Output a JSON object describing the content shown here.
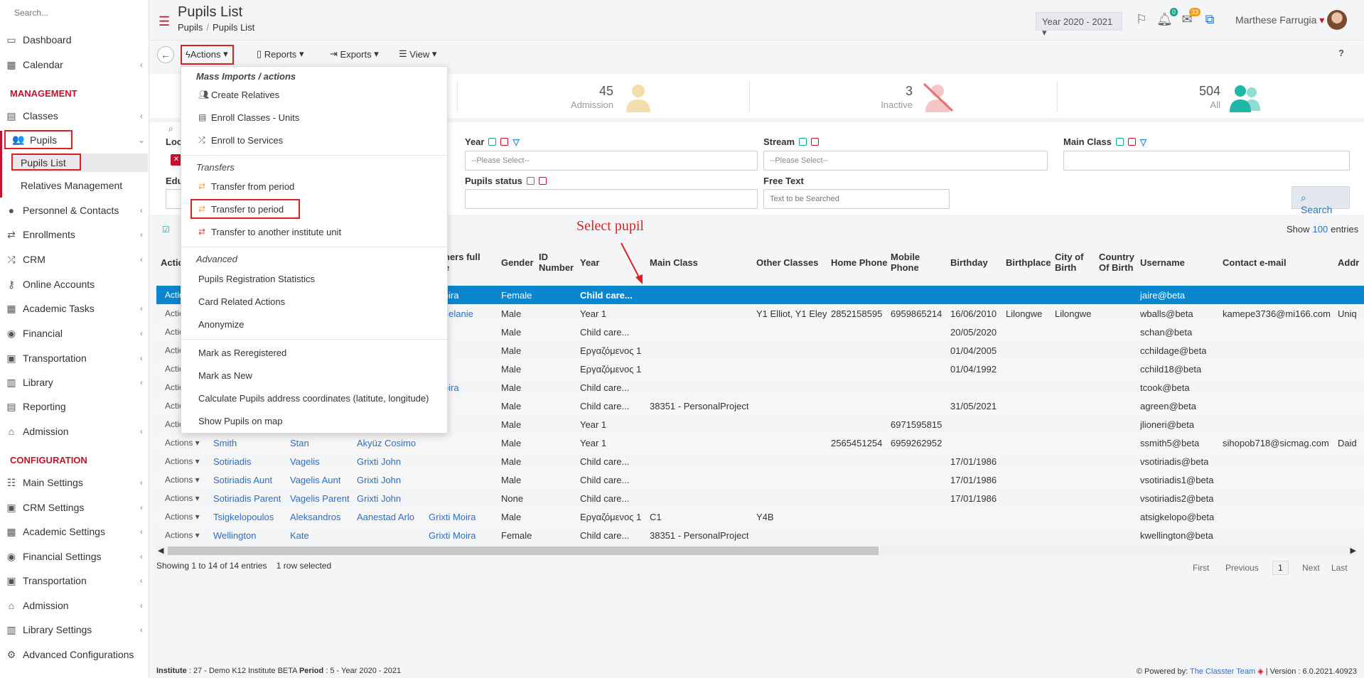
{
  "sidebar": {
    "search_placeholder": "Search...",
    "items": [
      {
        "label": "Dashboard",
        "icon": "monitor-icon"
      },
      {
        "label": "Calendar",
        "icon": "calendar-icon"
      },
      {
        "label": "Classes",
        "icon": "classes-icon"
      },
      {
        "label": "Pupils",
        "icon": "users-icon"
      },
      {
        "label": "Personnel & Contacts",
        "icon": "person-icon"
      },
      {
        "label": "Enrollments",
        "icon": "arrows-icon"
      },
      {
        "label": "CRM",
        "icon": "crm-icon"
      },
      {
        "label": "Online Accounts",
        "icon": "key-icon"
      },
      {
        "label": "Academic Tasks",
        "icon": "grid-icon"
      },
      {
        "label": "Financial",
        "icon": "coins-icon"
      },
      {
        "label": "Transportation",
        "icon": "bus-icon"
      },
      {
        "label": "Library",
        "icon": "books-icon"
      },
      {
        "label": "Reporting",
        "icon": "report-icon"
      },
      {
        "label": "Admission",
        "icon": "bank-icon"
      }
    ],
    "sections": {
      "management": "MANAGEMENT",
      "configuration": "CONFIGURATION"
    },
    "sub_items": [
      "Pupils List",
      "Relatives Management"
    ],
    "config_items": [
      "Main Settings",
      "CRM Settings",
      "Academic Settings",
      "Financial Settings",
      "Transportation",
      "Admission",
      "Library Settings",
      "Advanced Configurations"
    ]
  },
  "header": {
    "title": "Pupils List",
    "breadcrumb": [
      "Pupils",
      "Pupils List"
    ],
    "year": "Year 2020 - 2021",
    "notif_count": "0",
    "mail_count": "33",
    "user": "Marthese Farrugia"
  },
  "toolbar": {
    "actions": "Actions",
    "reports": "Reports",
    "exports": "Exports",
    "view": "View",
    "help": "?"
  },
  "stats": [
    {
      "num": "45",
      "label": "Admission"
    },
    {
      "num": "3",
      "label": "Inactive"
    },
    {
      "num": "504",
      "label": "All"
    }
  ],
  "filters": {
    "loc": "Loc",
    "edu": "Edu",
    "year": "Year",
    "stream": "Stream",
    "main_class": "Main Class",
    "pupils_status": "Pupils status",
    "free_text": "Free Text",
    "please_select": "--Please Select--",
    "free_text_placeholder": "Text to be Searched",
    "search": "Search",
    "show": "Show",
    "show_value": "100",
    "entries": "entries"
  },
  "annotation": "Select pupil",
  "menu": {
    "h1": "Mass Imports / actions",
    "create_relatives": "Create Relatives",
    "enroll_classes": "Enroll Classes - Units",
    "enroll_services": "Enroll to Services",
    "h2": "Transfers",
    "transfer_from": "Transfer from period",
    "transfer_to": "Transfer to period",
    "transfer_unit": "Transfer to another institute unit",
    "h3": "Advanced",
    "reg_stats": "Pupils Registration Statistics",
    "card_actions": "Card Related Actions",
    "anonymize": "Anonymize",
    "reregistered": "Mark as Reregistered",
    "mark_new": "Mark as New",
    "calc_coords": "Calculate Pupils address coordinates (latitute, longitude)",
    "show_map": "Show Pupils on map"
  },
  "table": {
    "headers": {
      "actions": "Actio",
      "others_a": "hers full",
      "others_b": "e",
      "gender": "Gender",
      "id_a": "ID",
      "id_b": "Number",
      "year": "Year",
      "main_class": "Main Class",
      "other_classes": "Other Classes",
      "home_phone": "Home Phone",
      "mobile_a": "Mobile",
      "mobile_b": "Phone",
      "birthday": "Birthday",
      "birthplace": "Birthplace",
      "city_a": "City of",
      "city_b": "Birth",
      "country_a": "Country",
      "country_b": "Of Birth",
      "username": "Username",
      "email": "Contact e-mail",
      "addr": "Addr"
    },
    "rows": [
      {
        "act": "Actio",
        "surname": "",
        "name": "",
        "father": "",
        "other": "ti Moira",
        "gender": "Female",
        "year": "Child care...",
        "main": "",
        "otherc": "",
        "home": "",
        "mobile": "",
        "bday": "",
        "bplace": "",
        "city": "",
        "user": "jaire@beta",
        "email": "",
        "addr": ""
      },
      {
        "act": "Actio",
        "surname": "",
        "name": "",
        "father": "",
        "other": "es Melanie",
        "gender": "Male",
        "year": "Year 1",
        "main": "",
        "otherc": "Y1 Elliot, Y1 Eley",
        "home": "2852158595",
        "mobile": "6959865214",
        "bday": "16/06/2010",
        "bplace": "Lilongwe",
        "city": "Lilongwe",
        "user": "wballs@beta",
        "email": "kamepe3736@mi166.com",
        "addr": "Uniq"
      },
      {
        "act": "Actio",
        "surname": "",
        "name": "",
        "father": "",
        "other": "",
        "gender": "Male",
        "year": "Child care...",
        "main": "",
        "otherc": "",
        "home": "",
        "mobile": "",
        "bday": "20/05/2020",
        "bplace": "",
        "city": "",
        "user": "schan@beta",
        "email": "",
        "addr": ""
      },
      {
        "act": "Actio",
        "surname": "",
        "name": "",
        "father": "",
        "other": "",
        "gender": "Male",
        "year": "Εργαζόμενος 1",
        "main": "",
        "otherc": "",
        "home": "",
        "mobile": "",
        "bday": "01/04/2005",
        "bplace": "",
        "city": "",
        "user": "cchildage@beta",
        "email": "",
        "addr": ""
      },
      {
        "act": "Actio",
        "surname": "",
        "name": "",
        "father": "",
        "other": "",
        "gender": "Male",
        "year": "Εργαζόμενος 1",
        "main": "",
        "otherc": "",
        "home": "",
        "mobile": "",
        "bday": "01/04/1992",
        "bplace": "",
        "city": "",
        "user": "cchild18@beta",
        "email": "",
        "addr": ""
      },
      {
        "act": "Actio",
        "surname": "",
        "name": "",
        "father": "",
        "other": "ti Moira",
        "gender": "Male",
        "year": "Child care...",
        "main": "",
        "otherc": "",
        "home": "",
        "mobile": "",
        "bday": "",
        "bplace": "",
        "city": "",
        "user": "tcook@beta",
        "email": "",
        "addr": ""
      },
      {
        "act": "Actio",
        "surname": "",
        "name": "",
        "father": "",
        "other": "",
        "gender": "Male",
        "year": "Child care...",
        "main": "38351 - PersonalProject",
        "otherc": "",
        "home": "",
        "mobile": "",
        "bday": "31/05/2021",
        "bplace": "",
        "city": "",
        "user": "agreen@beta",
        "email": "",
        "addr": ""
      },
      {
        "act": "Actio",
        "surname": "",
        "name": "",
        "father": "",
        "other": "",
        "gender": "Male",
        "year": "Year 1",
        "main": "",
        "otherc": "",
        "home": "",
        "mobile": "6971595815",
        "bday": "",
        "bplace": "",
        "city": "",
        "user": "jlioneri@beta",
        "email": "",
        "addr": ""
      },
      {
        "act": "Actions",
        "surname": "Smith",
        "name": "Stan",
        "father": "Akyüz Cosimo",
        "other": "",
        "gender": "Male",
        "year": "Year 1",
        "main": "",
        "otherc": "",
        "home": "2565451254",
        "mobile": "6959262952",
        "bday": "",
        "bplace": "",
        "city": "",
        "user": "ssmith5@beta",
        "email": "sihopob718@sicmag.com",
        "addr": "Daid"
      },
      {
        "act": "Actions",
        "surname": "Sotiriadis",
        "name": "Vagelis",
        "father": "Grixti John",
        "other": "",
        "gender": "Male",
        "year": "Child care...",
        "main": "",
        "otherc": "",
        "home": "",
        "mobile": "",
        "bday": "17/01/1986",
        "bplace": "",
        "city": "",
        "user": "vsotiriadis@beta",
        "email": "",
        "addr": ""
      },
      {
        "act": "Actions",
        "surname": "Sotiriadis Aunt",
        "name": "Vagelis Aunt",
        "father": "Grixti John",
        "other": "",
        "gender": "Male",
        "year": "Child care...",
        "main": "",
        "otherc": "",
        "home": "",
        "mobile": "",
        "bday": "17/01/1986",
        "bplace": "",
        "city": "",
        "user": "vsotiriadis1@beta",
        "email": "",
        "addr": ""
      },
      {
        "act": "Actions",
        "surname": "Sotiriadis Parent",
        "name": "Vagelis Parent",
        "father": "Grixti John",
        "other": "",
        "gender": "None",
        "year": "Child care...",
        "main": "",
        "otherc": "",
        "home": "",
        "mobile": "",
        "bday": "17/01/1986",
        "bplace": "",
        "city": "",
        "user": "vsotiriadis2@beta",
        "email": "",
        "addr": ""
      },
      {
        "act": "Actions",
        "surname": "Tsigkelopoulos",
        "name": "Aleksandros",
        "father": "Aanestad Arlo",
        "other": "Grixti Moira",
        "gender": "Male",
        "year": "Εργαζόμενος 1",
        "main": "C1",
        "otherc": "Y4B",
        "home": "",
        "mobile": "",
        "bday": "",
        "bplace": "",
        "city": "",
        "user": "atsigkelopo@beta",
        "email": "",
        "addr": ""
      },
      {
        "act": "Actions",
        "surname": "Wellington",
        "name": "Kate",
        "father": "",
        "other": "Grixti Moira",
        "gender": "Female",
        "year": "Child care...",
        "main": "38351 - PersonalProject",
        "otherc": "",
        "home": "",
        "mobile": "",
        "bday": "",
        "bplace": "",
        "city": "",
        "user": "kwellington@beta",
        "email": "",
        "addr": ""
      }
    ],
    "showing": "Showing 1 to 14 of 14 entries",
    "selected": "1 row selected",
    "pager": {
      "first": "First",
      "previous": "Previous",
      "page": "1",
      "next": "Next",
      "last": "Last"
    }
  },
  "footer": {
    "institute_label": "Institute",
    "institute_value": ": 27 - Demo K12 Institute BETA",
    "period_label": "Period",
    "period_value": ": 5 - Year 2020 - 2021",
    "powered": "Powered by:",
    "team": "The Classter Team",
    "version": "| Version : 6.0.2021.40923"
  },
  "colors": {
    "brand": "#c8102e",
    "selected_row": "#0a86cf",
    "link": "#2a6fc7",
    "annotation": "#e02020"
  }
}
